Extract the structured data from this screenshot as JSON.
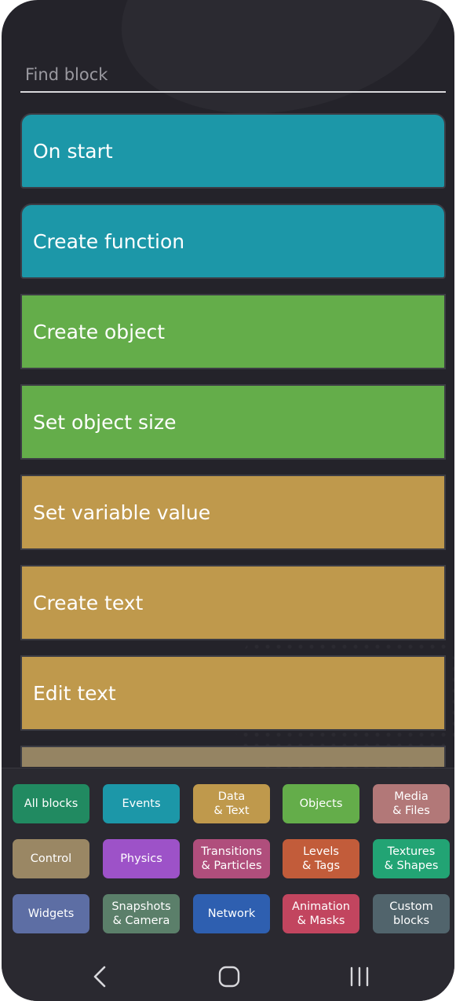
{
  "search": {
    "placeholder": "Find block"
  },
  "blocks": [
    {
      "label": "On start",
      "color": "#1c97a8"
    },
    {
      "label": "Create function",
      "color": "#1c97a8"
    },
    {
      "label": "Create object",
      "color": "#64ad4a"
    },
    {
      "label": "Set object size",
      "color": "#64ad4a"
    },
    {
      "label": "Set variable value",
      "color": "#bf994c"
    },
    {
      "label": "Create text",
      "color": "#bf994c"
    },
    {
      "label": "Edit text",
      "color": "#bf994c"
    },
    {
      "label": "",
      "color": "#958463"
    }
  ],
  "categories": [
    {
      "label": "All blocks",
      "color": "#218a61"
    },
    {
      "label": "Events",
      "color": "#1c97a8"
    },
    {
      "label": "Data\n& Text",
      "color": "#bf994c"
    },
    {
      "label": "Objects",
      "color": "#64ad4a"
    },
    {
      "label": "Media\n& Files",
      "color": "#b27878"
    },
    {
      "label": "Control",
      "color": "#9a8764"
    },
    {
      "label": "Physics",
      "color": "#9d52c8"
    },
    {
      "label": "Transitions\n& Particles",
      "color": "#b04e7c"
    },
    {
      "label": "Levels\n& Tags",
      "color": "#c25c3a"
    },
    {
      "label": "Textures\n& Shapes",
      "color": "#22a474"
    },
    {
      "label": "Widgets",
      "color": "#5d6ea4"
    },
    {
      "label": "Snapshots\n& Camera",
      "color": "#5b7f6a"
    },
    {
      "label": "Network",
      "color": "#2e5fb0"
    },
    {
      "label": "Animation\n& Masks",
      "color": "#c2455f"
    },
    {
      "label": "Custom\nblocks",
      "color": "#51646c"
    }
  ],
  "nav": {
    "back": "back-icon",
    "home": "home-icon",
    "recents": "recents-icon"
  }
}
